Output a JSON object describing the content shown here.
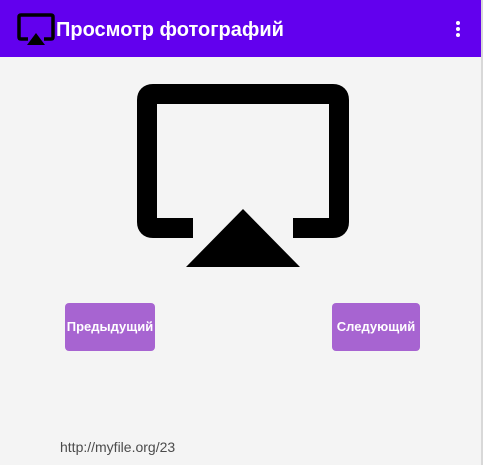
{
  "app_bar": {
    "title": "Просмотр фотографий",
    "icon": "airplay-icon",
    "menu_icon": "more-vertical-icon",
    "background": "#6200ee"
  },
  "content": {
    "image_icon": "airplay-icon"
  },
  "buttons": {
    "previous_label": "Предыдущий",
    "next_label": "Следующий",
    "color": "#a764d1"
  },
  "footer": {
    "url": "http://myfile.org/23"
  }
}
